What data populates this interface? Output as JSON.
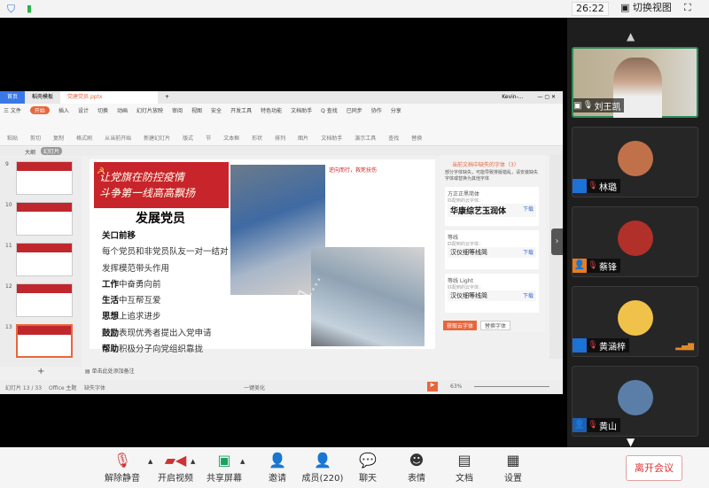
{
  "topbar": {
    "timer": "26:22",
    "switch_view": "切换视图"
  },
  "wps": {
    "tabs": [
      "首页",
      "稻壳模板",
      "党建党员.pptx"
    ],
    "user": "Kevin-...",
    "menu": [
      "三 文件",
      "开始",
      "插入",
      "设计",
      "切换",
      "动画",
      "幻灯片放映",
      "审阅",
      "视图",
      "安全",
      "开发工具",
      "特色功能",
      "文档助手",
      "Q 查找",
      "已同步",
      "协作",
      "分享"
    ],
    "ribbon": [
      "粘贴",
      "剪切",
      "复制",
      "格式刷",
      "从当前开始",
      "新建幻灯片",
      "版式",
      "节",
      "文本框",
      "形状",
      "排列",
      "图片",
      "文档助手",
      "演示工具",
      "查找",
      "替换"
    ],
    "outline_tabs": [
      "大纲",
      "幻灯片"
    ],
    "thumb_numbers": [
      "9",
      "10",
      "11",
      "12",
      "13"
    ],
    "notes_placeholder": "单击此处添加备注",
    "status": {
      "slide": "幻灯片 13 / 33",
      "theme": "Office 主题",
      "font_missing": "缺失字体",
      "beautify": "一键美化",
      "zoom": "63%"
    }
  },
  "slide": {
    "banner": [
      "让党旗在防控疫情",
      "斗争第一线高高飘扬"
    ],
    "title": "发展党员",
    "lines": [
      {
        "b": "关口前移",
        "t": ""
      },
      {
        "b": "",
        "t": "每个党员和非党员队友一对一结对"
      },
      {
        "b": "",
        "t": "发挥模范带头作用"
      },
      {
        "b": "工作",
        "t": "中奋勇向前"
      },
      {
        "b": "生活",
        "t": "中互帮互爱"
      },
      {
        "b": "思想",
        "t": "上追求进步"
      },
      {
        "b": "鼓励",
        "t": "表现优秀者提出入党申请"
      },
      {
        "b": "帮助",
        "t": "积极分子向党组织靠拢"
      }
    ],
    "caption": "逆向而行，救死扶伤",
    "watermark": "+861..."
  },
  "font_panel": {
    "title": "当前文档中缺失的字体（3）",
    "desc": "部分字体缺失，可能导致排版错乱，请安装缺失字体或替换为其他字体",
    "cards": [
      {
        "name": "方正正黑简体",
        "label": "匹配到的云字体：",
        "match": "华康综艺玉润体",
        "dl": "下载"
      },
      {
        "name": "等线",
        "label": "匹配到的云字体：",
        "match": "汉仪细等线简",
        "dl": "下载"
      },
      {
        "name": "等线 Light",
        "label": "匹配到的云字体：",
        "match": "汉仪细等线简",
        "dl": "下载"
      }
    ],
    "btn_primary": "获取云字体",
    "btn_secondary": "替换字体"
  },
  "participants": [
    {
      "name": "刘王凯",
      "type": "video"
    },
    {
      "name": "林璐",
      "role_color": "#1f6fd6",
      "avatar": "#c0714a"
    },
    {
      "name": "蔡锋",
      "role_color": "#e67e22",
      "avatar": "#b2302a"
    },
    {
      "name": "黄涵梓",
      "role_color": "#1f6fd6",
      "avatar": "#f0c24a"
    },
    {
      "name": "黄山",
      "role_color": "#1f5fb0",
      "avatar": "#5a7ea8"
    }
  ],
  "toolbar": {
    "unmute": "解除静音",
    "video": "开启视频",
    "share": "共享屏幕",
    "invite": "邀请",
    "members": "成员(220)",
    "chat": "聊天",
    "emoji": "表情",
    "docs": "文档",
    "settings": "设置",
    "leave": "离开会议"
  }
}
